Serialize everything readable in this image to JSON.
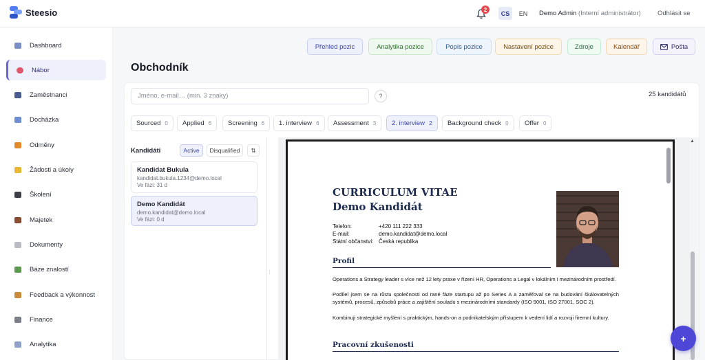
{
  "app": {
    "name": "Steesio"
  },
  "header": {
    "notifications_count": "2",
    "lang_cs": "CS",
    "lang_en": "EN",
    "user_name": "Demo Admin",
    "user_role": "(Interní administrátor)",
    "logout": "Odhlásit se"
  },
  "sidebar": {
    "items": [
      {
        "label": "Dashboard",
        "icon": "chart-icon",
        "color": "#7b8fc9"
      },
      {
        "label": "Nábor",
        "icon": "target-icon",
        "color": "#e0576b",
        "active": true
      },
      {
        "label": "Zaměstnanci",
        "icon": "people-icon",
        "color": "#4a5c8f"
      },
      {
        "label": "Docházka",
        "icon": "calendar-icon",
        "color": "#6e8fd1"
      },
      {
        "label": "Odměny",
        "icon": "gift-icon",
        "color": "#e08a2c"
      },
      {
        "label": "Žádosti a úkoly",
        "icon": "tasks-icon",
        "color": "#e8b733"
      },
      {
        "label": "Školení",
        "icon": "graduation-cap-icon",
        "color": "#3c3f48"
      },
      {
        "label": "Majetek",
        "icon": "briefcase-icon",
        "color": "#8a4b33"
      },
      {
        "label": "Dokumenty",
        "icon": "document-icon",
        "color": "#b9bcc4"
      },
      {
        "label": "Báze znalostí",
        "icon": "books-icon",
        "color": "#5c9a52"
      },
      {
        "label": "Feedback a výkonnost",
        "icon": "clipboard-icon",
        "color": "#c98a3c"
      },
      {
        "label": "Finance",
        "icon": "bank-icon",
        "color": "#7a7f8a"
      },
      {
        "label": "Analytika",
        "icon": "analytics-icon",
        "color": "#8fa0c9"
      }
    ]
  },
  "actions": [
    {
      "label": "Přehled pozic",
      "bg": "#eef1fb",
      "border": "#c9cff0",
      "color": "#3a45a8"
    },
    {
      "label": "Analytika pozice",
      "bg": "#eef8ee",
      "border": "#c9e6c9",
      "color": "#2f6e2f"
    },
    {
      "label": "Popis pozice",
      "bg": "#eef4fb",
      "border": "#cddff0",
      "color": "#2f5a8c"
    },
    {
      "label": "Nastavení pozice",
      "bg": "#fdf6e8",
      "border": "#f0dcae",
      "color": "#6e4a12"
    },
    {
      "label": "Zdroje",
      "bg": "#eefaf2",
      "border": "#c6ead3",
      "color": "#2a6b43"
    },
    {
      "label": "Kalendář",
      "bg": "#fdf4ea",
      "border": "#f2d7b5",
      "color": "#8a4b12"
    },
    {
      "label": "Pošta",
      "bg": "#f4f2fc",
      "border": "#d5d0ef",
      "color": "#33306e"
    }
  ],
  "page": {
    "title": "Obchodník",
    "search_placeholder": "Jméno, e-mail… (min. 3 znaky)",
    "help": "?",
    "count": "25 kandidátů"
  },
  "stages": [
    {
      "label": "Sourced",
      "n": "0"
    },
    {
      "label": "Applied",
      "n": "6"
    },
    {
      "label": "Screening",
      "n": "6"
    },
    {
      "label": "1. interview",
      "n": "6"
    },
    {
      "label": "Assessment",
      "n": "3"
    },
    {
      "label": "2. interview",
      "n": "2",
      "active": true
    },
    {
      "label": "Background check",
      "n": "0"
    },
    {
      "label": "Offer",
      "n": "0"
    }
  ],
  "candidates_panel": {
    "heading": "Kandidáti",
    "filter_active": "Active",
    "filter_disqualified": "Disqualified",
    "sort": "⇅",
    "items": [
      {
        "name": "Kandidat Bukula",
        "email": "kandidat.bukula.1234@demo.local",
        "phase": "Ve fázi: 31 d"
      },
      {
        "name": "Demo Kandidát",
        "email": "demo.kandidat@demo.local",
        "phase": "Ve fázi: 0 d"
      }
    ]
  },
  "cv": {
    "title": "CURRICULUM VITAE",
    "name": "Demo Kandidát",
    "phone_label": "Telefon:",
    "phone": "+420 111 222 333",
    "email_label": "E-mail:",
    "email": "demo.kandidat@demo.local",
    "citizenship_label": "Státní občanství:",
    "citizenship": "Česká republika",
    "profile_heading": "Profil",
    "profile_text": "Operations a Strategy leader s více než 12 lety praxe v řízení HR, Operations a Legal v lokálním i mezinárodním prostředí.",
    "profile_text2": "Podílel jsem se na růstu společnosti od rané fáze startupu až po Series A a zaměřoval se na budování škálovatelných systémů, procesů, způsobů práce a zajištění souladu s mezinárodními standardy (ISO 9001, ISO 27001, SOC 2).",
    "profile_text3": "Kombinuji strategické myšlení s praktickým, hands-on a podnikatelským přístupem k vedení lidí a rozvoji firemní kultury.",
    "experience_heading": "Pracovní zkušenosti"
  },
  "fab": "+"
}
